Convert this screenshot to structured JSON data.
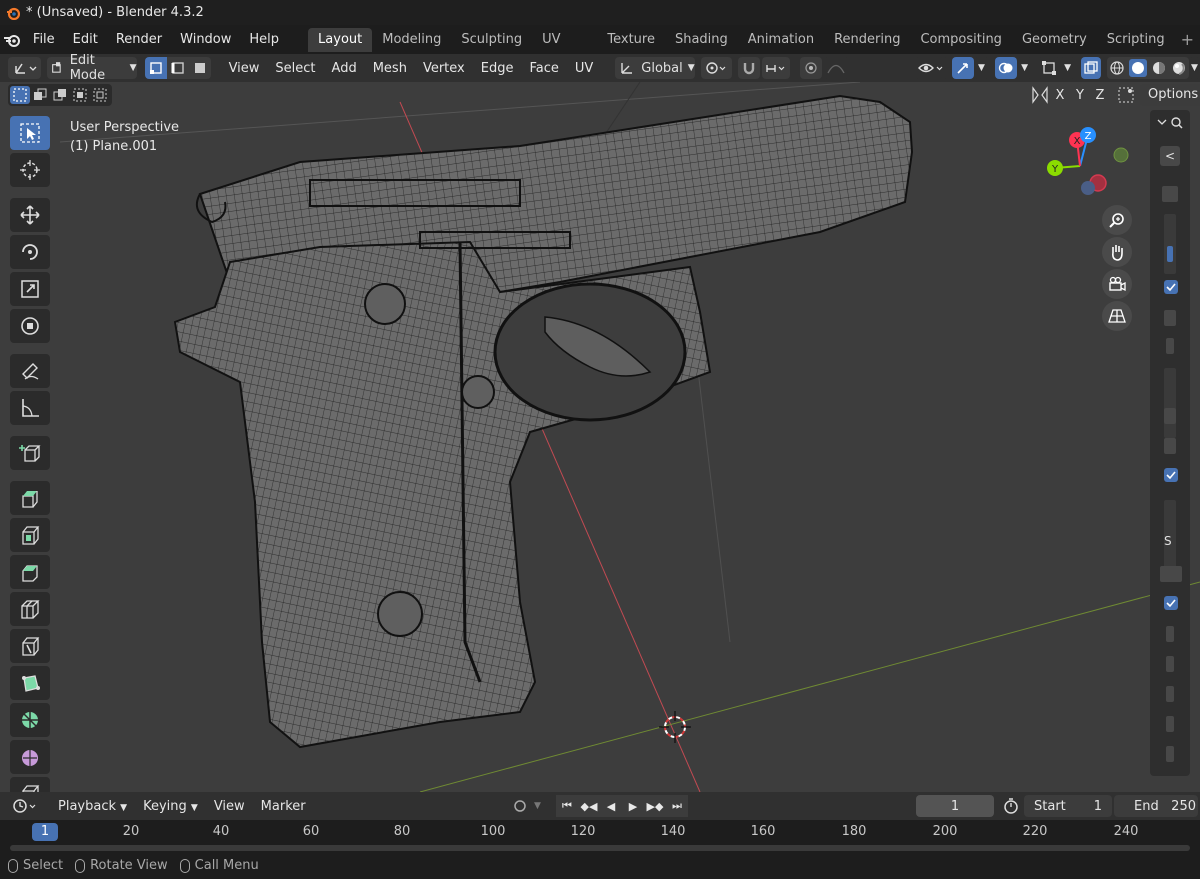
{
  "window": {
    "title": "* (Unsaved) - Blender 4.3.2"
  },
  "menubar": {
    "items": [
      "File",
      "Edit",
      "Render",
      "Window",
      "Help"
    ],
    "workspaces": [
      "Layout",
      "Modeling",
      "Sculpting",
      "UV Editing",
      "Texture Paint",
      "Shading",
      "Animation",
      "Rendering",
      "Compositing",
      "Geometry Nodes",
      "Scripting"
    ],
    "active_workspace": "Layout",
    "add_label": "+"
  },
  "header": {
    "mode": "Edit Mode",
    "menus": [
      "View",
      "Select",
      "Add",
      "Mesh",
      "Vertex",
      "Edge",
      "Face",
      "UV"
    ],
    "transform_orientation": "Global"
  },
  "viewport": {
    "perspective_label": "User Perspective",
    "object_label": "(1) Plane.001",
    "axes": {
      "x": "X",
      "y": "Y",
      "z": "Z"
    },
    "options_label": "Options",
    "npanel_letter": "S",
    "colors": {
      "x_axis": "#ff3352",
      "y_axis": "#8bdc00",
      "z_axis": "#2890ff",
      "active": "#4772b3"
    }
  },
  "timeline": {
    "menus": [
      "Playback",
      "Keying",
      "View",
      "Marker"
    ],
    "current_frame": "1",
    "start_label": "Start",
    "start_value": "1",
    "end_label": "End",
    "end_value": "250",
    "ruler_labels": [
      "20",
      "40",
      "60",
      "80",
      "100",
      "120",
      "140",
      "160",
      "180",
      "200",
      "220",
      "240"
    ],
    "ruler_current": "1"
  },
  "statusbar": {
    "items": [
      "Select",
      "Rotate View",
      "Call Menu"
    ]
  }
}
